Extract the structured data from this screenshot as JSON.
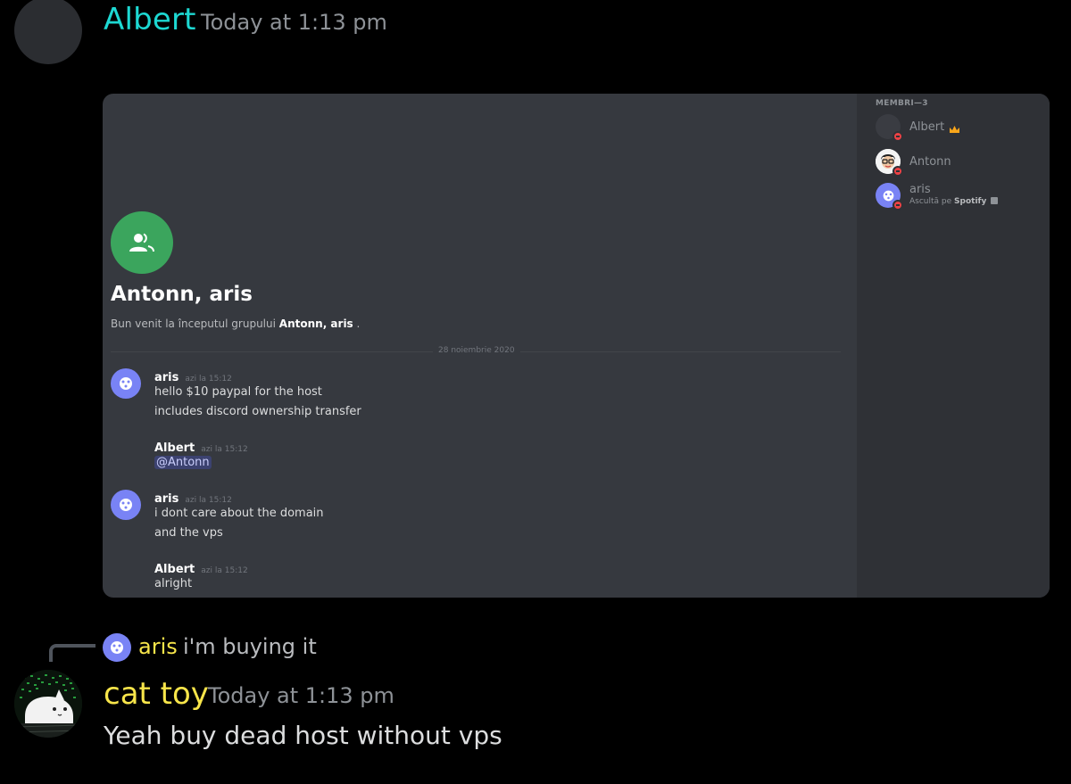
{
  "top_message": {
    "author": "Albert",
    "timestamp": "Today at 1:13 pm",
    "author_color": "#1dd8d2"
  },
  "embed": {
    "group_title": "Antonn, aris",
    "welcome_prefix": "Bun venit la începutul grupului",
    "welcome_group": "Antonn, aris",
    "welcome_suffix": ".",
    "date_separator": "28 noiembrie 2020",
    "messages": [
      {
        "author": "aris",
        "timestamp": "azi la 15:12",
        "lines": [
          "hello $10 paypal for the host",
          "includes discord ownership transfer"
        ]
      },
      {
        "author": "Albert",
        "timestamp": "azi la 15:12",
        "mention": "@Antonn"
      },
      {
        "author": "aris",
        "timestamp": "azi la 15:12",
        "lines": [
          "i dont care about the domain",
          "and the vps"
        ]
      },
      {
        "author": "Albert",
        "timestamp": "azi la 15:12",
        "lines": [
          "alright"
        ]
      }
    ],
    "members": {
      "header": "MEMBRI—3",
      "list": [
        {
          "name": "Albert",
          "icon": "crown-icon",
          "sub": ""
        },
        {
          "name": "Antonn",
          "icon": "",
          "sub": ""
        },
        {
          "name": "aris",
          "icon": "",
          "sub_prefix": "Ascultă pe",
          "sub_bold": "Spotify"
        }
      ]
    }
  },
  "reply": {
    "author": "aris",
    "text": "i'm buying it"
  },
  "bottom_message": {
    "author": "cat toy",
    "timestamp": "Today at 1:13 pm",
    "text": "Yeah buy dead host without vps",
    "author_color": "#f7e54a"
  }
}
